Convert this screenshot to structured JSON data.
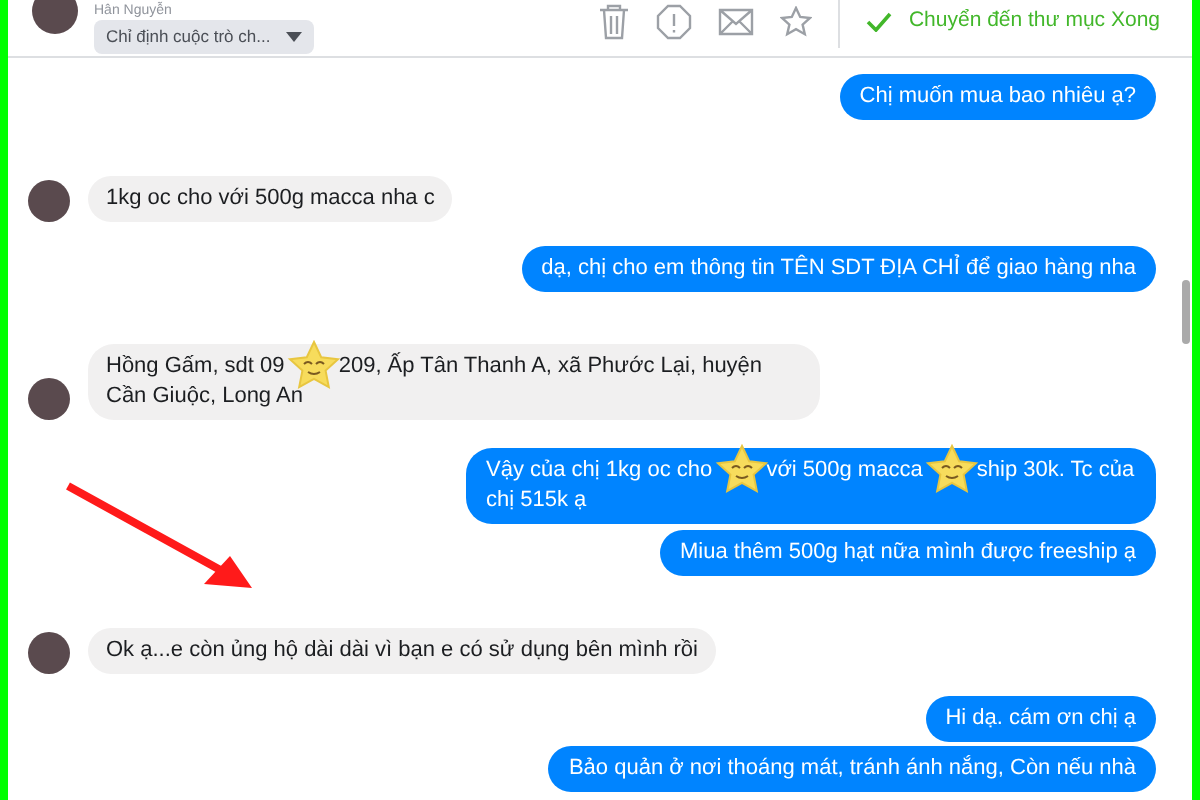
{
  "header": {
    "contact_name": "Hân Nguyễn",
    "assign_button": "Chỉ định cuộc trò ch...",
    "move_to_done": "Chuyển đến thư mục Xong"
  },
  "messages": [
    {
      "kind": "sent",
      "parts": [
        "Chị muốn mua bao nhiêu ạ?"
      ]
    },
    {
      "kind": "received",
      "parts": [
        "1kg oc cho với 500g macca nha c"
      ]
    },
    {
      "kind": "sent",
      "parts": [
        "dạ, chị cho em thông tin TÊN SDT ĐỊA CHỈ để giao hàng nha"
      ]
    },
    {
      "kind": "received",
      "parts": [
        "Hồng Gấm, sdt 09",
        "209, Ấp Tân Thanh A, xã Phước Lại, huyện Cần Giuộc, Long An"
      ]
    },
    {
      "kind": "sent",
      "parts": [
        "Vậy của chị 1kg oc cho",
        "với 500g macca",
        "ship 30k. Tc của chị 515k ạ"
      ]
    },
    {
      "kind": "sent",
      "parts": [
        "Miua thêm 500g hạt nữa mình được freeship ạ"
      ]
    },
    {
      "kind": "received",
      "parts": [
        "Ok ạ...e còn ủng hộ dài dài vì bạn e có sử dụng bên mình rồi"
      ]
    },
    {
      "kind": "sent",
      "parts": [
        "Hi dạ. cám ơn chị ạ"
      ]
    },
    {
      "kind": "sent",
      "parts": [
        "Bảo quản ở nơi thoáng mát, tránh ánh nắng, Còn nếu nhà"
      ]
    }
  ]
}
